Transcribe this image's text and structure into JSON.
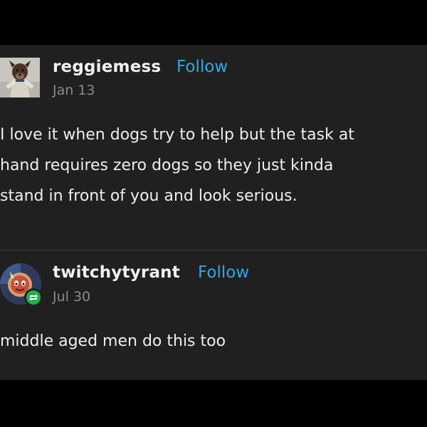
{
  "posts": [
    {
      "username": "reggiemess",
      "follow_label": "Follow",
      "date": "Jan 13",
      "avatar": "dog-character-avatar",
      "body_lines": [
        "I love it when dogs try to help but the task at",
        "hand requires zero dogs so they just kinda",
        "stand in front of you and look serious."
      ]
    },
    {
      "username": "twitchytyrant",
      "follow_label": "Follow",
      "date": "Jul 30",
      "avatar": "round-cartoon-avatar",
      "badge_icon": "reblog-icon",
      "body_lines": [
        "middle aged men do this too"
      ]
    }
  ],
  "colors": {
    "background": "#000000",
    "panel": "#202020",
    "follow": "#2ba9e6",
    "reblog_badge": "#19b24b",
    "text": "#eeeeee",
    "muted": "#8a8a8a"
  }
}
